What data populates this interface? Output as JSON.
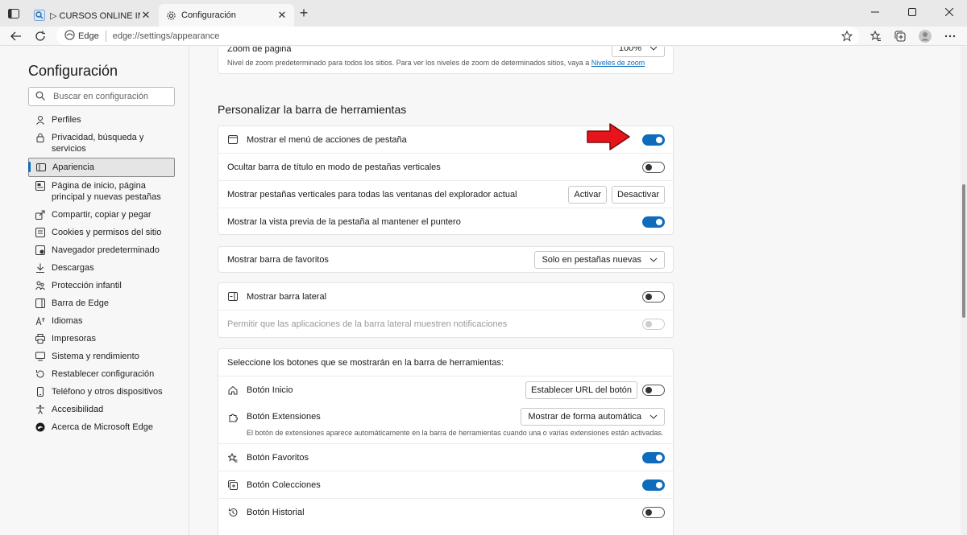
{
  "tabs": [
    {
      "title": "▷ CURSOS ONLINE INFORMATICA",
      "active": false
    },
    {
      "title": "Configuración",
      "active": true
    }
  ],
  "address": {
    "site": "Edge",
    "url": "edge://settings/appearance"
  },
  "sidebar": {
    "title": "Configuración",
    "search_placeholder": "Buscar en configuración",
    "items": [
      {
        "label": "Perfiles",
        "icon": "profile-icon"
      },
      {
        "label": "Privacidad, búsqueda y servicios",
        "icon": "lock-icon"
      },
      {
        "label": "Apariencia",
        "icon": "appearance-icon",
        "active": true
      },
      {
        "label": "Página de inicio, página principal y nuevas pestañas",
        "icon": "home-icon"
      },
      {
        "label": "Compartir, copiar y pegar",
        "icon": "share-icon"
      },
      {
        "label": "Cookies y permisos del sitio",
        "icon": "cookie-icon"
      },
      {
        "label": "Navegador predeterminado",
        "icon": "browser-icon"
      },
      {
        "label": "Descargas",
        "icon": "download-icon"
      },
      {
        "label": "Protección infantil",
        "icon": "family-icon"
      },
      {
        "label": "Barra de Edge",
        "icon": "edge-bar-icon"
      },
      {
        "label": "Idiomas",
        "icon": "language-icon"
      },
      {
        "label": "Impresoras",
        "icon": "printer-icon"
      },
      {
        "label": "Sistema y rendimiento",
        "icon": "system-icon"
      },
      {
        "label": "Restablecer configuración",
        "icon": "reset-icon"
      },
      {
        "label": "Teléfono y otros dispositivos",
        "icon": "phone-icon"
      },
      {
        "label": "Accesibilidad",
        "icon": "accessibility-icon"
      },
      {
        "label": "Acerca de Microsoft Edge",
        "icon": "edge-logo-icon"
      }
    ]
  },
  "zoom": {
    "label": "Zoom de página",
    "value": "100%",
    "desc": "Nivel de zoom predeterminado para todos los sitios. Para ver los niveles de zoom de determinados sitios, vaya a",
    "link": "Niveles de zoom"
  },
  "section_title": "Personalizar la barra de herramientas",
  "toolbar_rows": {
    "tab_actions": "Mostrar el menú de acciones de pestaña",
    "hide_title_bar": "Ocultar barra de título en modo de pestañas verticales",
    "vertical_tabs_all": "Mostrar pestañas verticales para todas las ventanas del explorador actual",
    "activate": "Activar",
    "deactivate": "Desactivar",
    "tab_preview": "Mostrar la vista previa de la pestaña al mantener el puntero"
  },
  "favorites_bar": {
    "label": "Mostrar barra de favoritos",
    "value": "Solo en pestañas nuevas"
  },
  "sidebar_settings": {
    "show_sidebar": "Mostrar barra lateral",
    "notifications": "Permitir que las aplicaciones de la barra lateral muestren notificaciones"
  },
  "buttons_section": {
    "heading": "Seleccione los botones que se mostrarán en la barra de herramientas:",
    "home": "Botón Inicio",
    "set_url": "Establecer URL del botón",
    "extensions": "Botón Extensiones",
    "extensions_value": "Mostrar de forma automática",
    "extensions_desc": "El botón de extensiones aparece automáticamente en la barra de herramientas cuando una o varias extensiones están activadas.",
    "favorites": "Botón Favoritos",
    "collections": "Botón Colecciones",
    "history": "Botón Historial"
  },
  "colors": {
    "accent": "#0f6cbd",
    "arrow": "#e8141c"
  }
}
